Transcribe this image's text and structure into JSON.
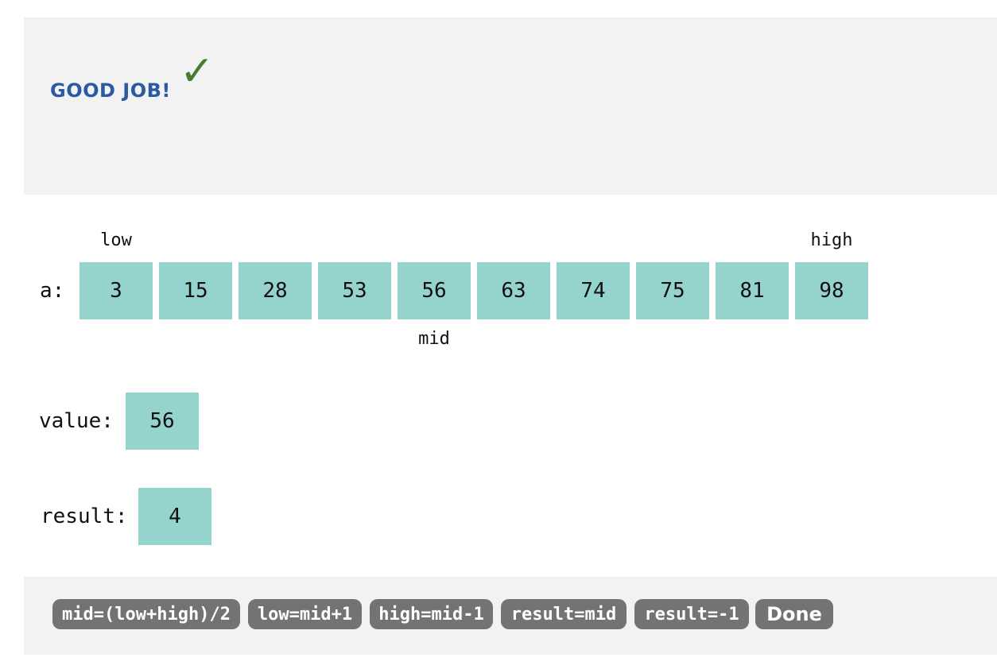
{
  "feedback": {
    "message": "GOOD JOB!",
    "icon": "check-icon"
  },
  "array": {
    "label": "a:",
    "cells": [
      "3",
      "15",
      "28",
      "53",
      "56",
      "63",
      "74",
      "75",
      "81",
      "98"
    ],
    "pointers": {
      "low": "low",
      "high": "high",
      "mid": "mid"
    }
  },
  "value": {
    "label": "value:",
    "cell": "56"
  },
  "result": {
    "label": "result:",
    "cell": "4"
  },
  "code_blocks": [
    "mid=(low+high)/2",
    "low=mid+1",
    "high=mid-1",
    "result=mid",
    "result=-1"
  ],
  "done_label": "Done",
  "colors": {
    "cell": "#95d4cd",
    "chip": "#737373",
    "feedback_text": "#2a5aa3",
    "check": "#4a7a30",
    "panel": "#f2f2f2"
  }
}
